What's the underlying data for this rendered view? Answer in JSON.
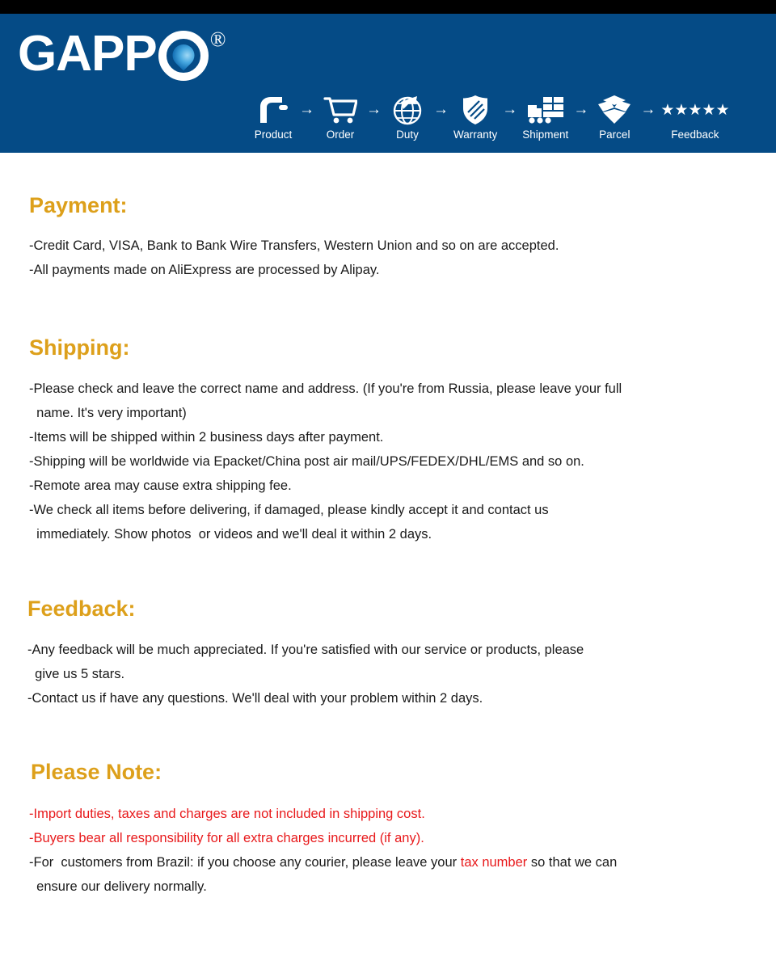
{
  "brand": {
    "logo_text": "GAPP",
    "logo_mark": "water-drop-o",
    "registered_mark": "®",
    "banner_color": "#054b86",
    "topbar_color": "#000000",
    "heading_color": "#dda01b",
    "alert_color": "#e8191b"
  },
  "process_steps": [
    {
      "label": "Product",
      "icon": "faucet-icon"
    },
    {
      "label": "Order",
      "icon": "shopping-cart-icon"
    },
    {
      "label": "Duty",
      "icon": "globe-airplane-icon"
    },
    {
      "label": "Warranty",
      "icon": "shield-icon"
    },
    {
      "label": "Shipment",
      "icon": "delivery-truck-icon"
    },
    {
      "label": "Parcel",
      "icon": "open-box-icon"
    },
    {
      "label": "Feedback",
      "icon": "five-stars-icon",
      "stars": "★★★★★"
    }
  ],
  "step_arrow": "→",
  "sections": {
    "payment": {
      "title": "Payment:",
      "lines": [
        "-Credit Card, VISA, Bank to Bank Wire Transfers, Western Union and so on are accepted.",
        "-All payments made on AliExpress are processed by Alipay."
      ]
    },
    "shipping": {
      "title": "Shipping:",
      "lines": [
        "-Please check and leave the correct name and address. (If you're from Russia, please leave your full\n  name. It's very important)",
        "-Items will be shipped within 2 business days after payment.",
        "-Shipping will be worldwide via Epacket/China post air mail/UPS/FEDEX/DHL/EMS and so on.",
        "-Remote area may cause extra shipping fee.",
        "-We check all items before delivering, if damaged, please kindly accept it and contact us\n  immediately. Show photos  or videos and we'll deal it within 2 days."
      ]
    },
    "feedback": {
      "title": "Feedback:",
      "lines": [
        "-Any feedback will be much appreciated. If you're satisfied with our service or products, please\n  give us 5 stars.",
        "-Contact us if have any questions. We'll deal with your problem within 2 days."
      ]
    },
    "note": {
      "title": "Please Note:",
      "line_red_1": "-Import duties, taxes and charges are not included in shipping cost.",
      "line_red_2": "-Buyers bear all responsibility for all extra charges incurred (if any).",
      "line_3_part1": "-For  customers from Brazil: if you choose any courier, please leave your ",
      "line_3_highlight": "tax number",
      "line_3_part2": " so that we can\n  ensure our delivery normally."
    }
  }
}
